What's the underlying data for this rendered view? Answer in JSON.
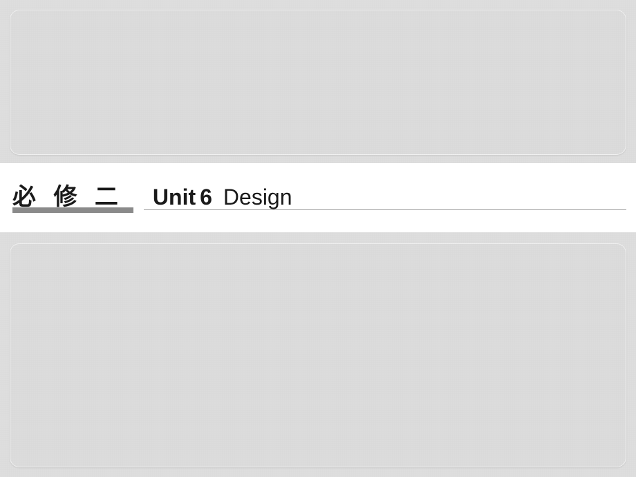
{
  "title": {
    "chinese": "必 修 二",
    "unit_prefix": "Unit",
    "unit_number": "6",
    "unit_name": "Design"
  }
}
